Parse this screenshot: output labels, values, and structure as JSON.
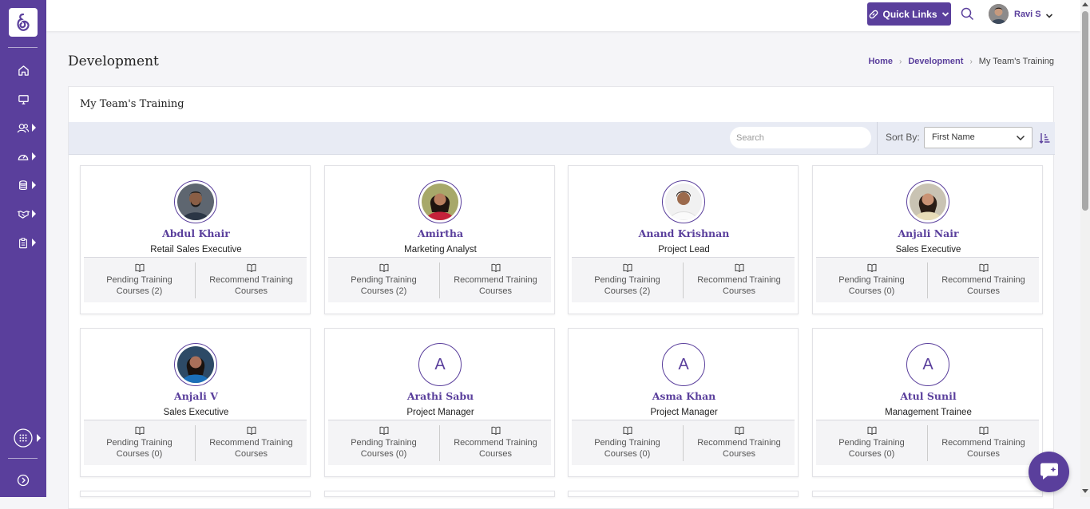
{
  "header": {
    "quick_links_label": "Quick Links",
    "user_name": "Ravi S"
  },
  "page": {
    "title": "Development",
    "breadcrumb": [
      "Home",
      "Development",
      "My Team's Training"
    ]
  },
  "panel": {
    "title": "My Team's Training",
    "search_placeholder": "Search",
    "sort_label": "Sort By:",
    "sort_value": "First Name"
  },
  "card_labels": {
    "recommend_line1": "Recommend Training",
    "recommend_line2": "Courses",
    "pending_line1": "Pending Training"
  },
  "employees": [
    {
      "name": "Abdul Khair",
      "role": "Retail Sales Executive",
      "pending": "Courses (2)",
      "initial": ""
    },
    {
      "name": "Amirtha",
      "role": "Marketing Analyst",
      "pending": "Courses (2)",
      "initial": ""
    },
    {
      "name": "Anand Krishnan",
      "role": "Project Lead",
      "pending": "Courses (2)",
      "initial": ""
    },
    {
      "name": "Anjali Nair",
      "role": "Sales Executive",
      "pending": "Courses (0)",
      "initial": ""
    },
    {
      "name": "Anjali V",
      "role": "Sales Executive",
      "pending": "Courses (0)",
      "initial": ""
    },
    {
      "name": "Arathi Sabu",
      "role": "Project Manager",
      "pending": "Courses (0)",
      "initial": "A"
    },
    {
      "name": "Asma Khan",
      "role": "Project Manager",
      "pending": "Courses (0)",
      "initial": "A"
    },
    {
      "name": "Atul Sunil",
      "role": "Management Trainee",
      "pending": "Courses (0)",
      "initial": "A"
    }
  ],
  "colors": {
    "brand": "#5a3f9c",
    "toolbar_bg": "#e8ebf4"
  }
}
